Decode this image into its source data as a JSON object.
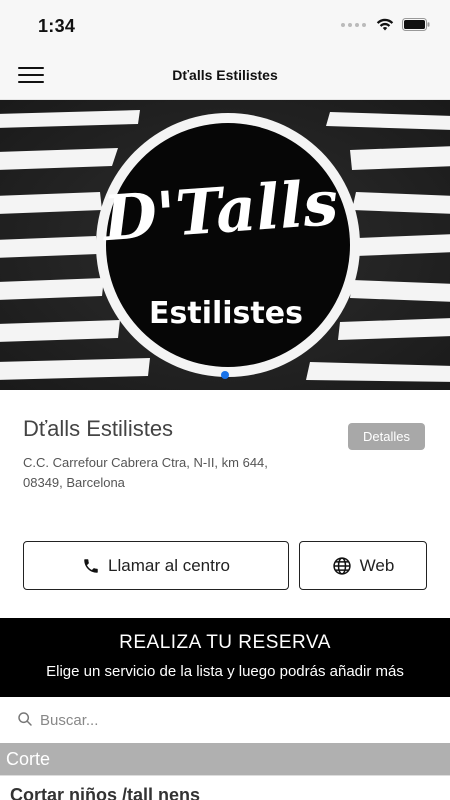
{
  "status_bar": {
    "time": "1:34"
  },
  "nav": {
    "title": "Dťalls Estilistes"
  },
  "hero": {
    "logo_main": "D'Talls",
    "logo_sub": "Estilistes",
    "carousel_active": 1,
    "carousel_total": 1
  },
  "salon": {
    "name": "Dťalls Estilistes",
    "details_label": "Detalles",
    "address_line1": "C.C. Carrefour Cabrera Ctra, N-II, km 644,",
    "address_line2": "08349, Barcelona"
  },
  "actions": {
    "call_label": "Llamar al centro",
    "web_label": "Web"
  },
  "booking": {
    "title": "REALIZA TU RESERVA",
    "subtitle": "Elige un servicio de la lista y luego podrás añadir más"
  },
  "search": {
    "placeholder": "Buscar..."
  },
  "services": {
    "category": "Corte",
    "items": [
      {
        "label": "Cortar niños /tall nens"
      }
    ]
  },
  "colors": {
    "accent_dot": "#1a73e8",
    "banner_bg": "#000000",
    "details_bg": "#a8a8a8",
    "category_bg": "#b0b0b0"
  },
  "icons": [
    "menu-icon",
    "wifi-icon",
    "battery-icon",
    "phone-icon",
    "globe-icon",
    "search-icon"
  ]
}
